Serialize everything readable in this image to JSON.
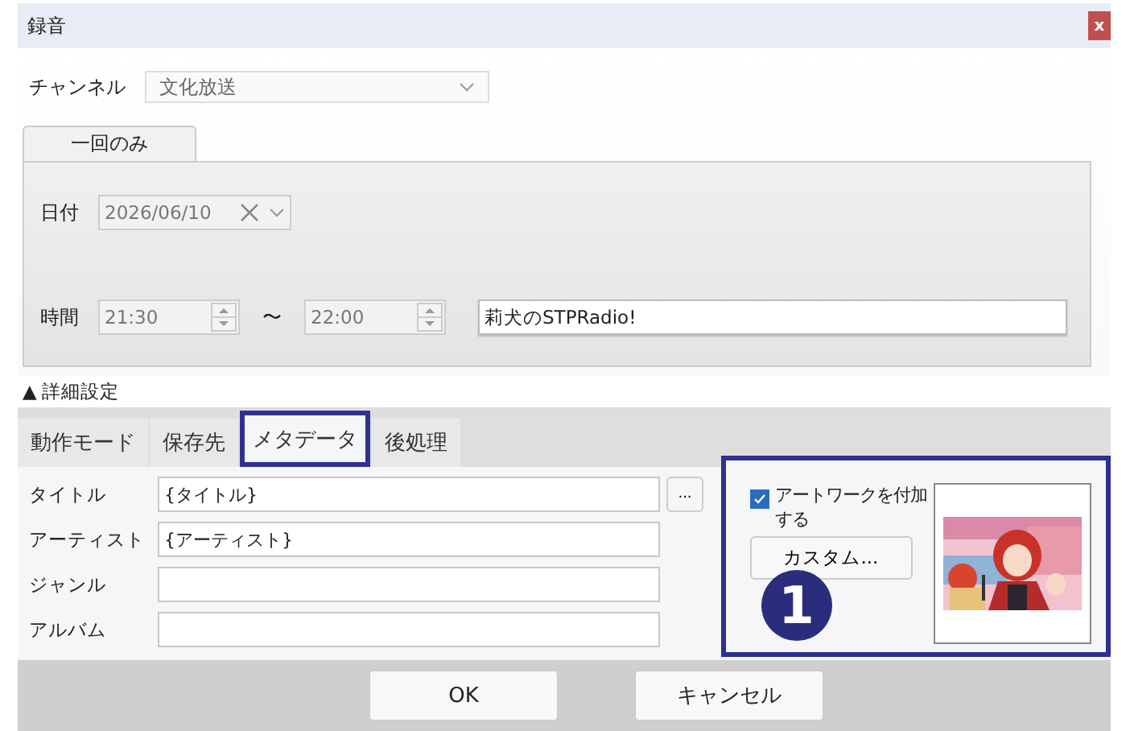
{
  "window": {
    "title": "録音",
    "close": "x"
  },
  "channel": {
    "label": "チャンネル",
    "value": "文化放送"
  },
  "schedule_tabs": [
    {
      "label": "一回のみ",
      "selected": true
    }
  ],
  "date": {
    "label": "日付",
    "value": "2026/06/10"
  },
  "time": {
    "label": "時間",
    "start": "21:30",
    "separator": "〜",
    "end": "22:00",
    "program": "莉犬のSTPRadio!"
  },
  "details": {
    "icon": "▲",
    "label": "詳細設定"
  },
  "tabs": [
    {
      "label": "動作モード",
      "selected": false
    },
    {
      "label": "保存先",
      "selected": false
    },
    {
      "label": "メタデータ",
      "selected": true
    },
    {
      "label": "後処理",
      "selected": false
    }
  ],
  "metadata_fields": [
    {
      "label": "タイトル",
      "value": "{タイトル}",
      "button": "..."
    },
    {
      "label": "アーティスト",
      "value": "{アーティスト}"
    },
    {
      "label": "ジャンル"
    },
    {
      "label": "アルバム"
    }
  ],
  "artwork": {
    "label": "アートワークを付加する",
    "checked": true,
    "custom_button": "カスタム..."
  },
  "callout": "1",
  "buttons": [
    "OK",
    "キャンセル"
  ]
}
